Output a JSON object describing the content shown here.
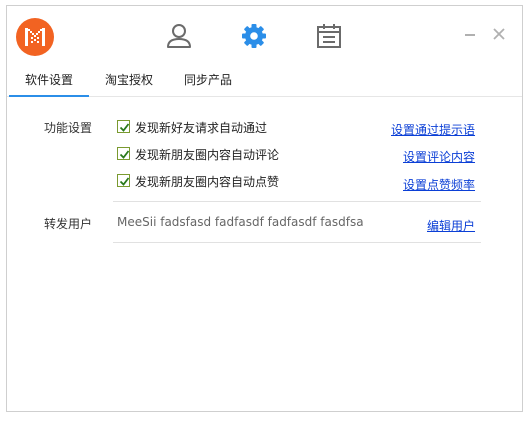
{
  "header": {
    "icons": [
      "app-logo",
      "user-icon",
      "gear-icon",
      "calendar-icon"
    ],
    "active_icon": "gear-icon",
    "accent_color": "#2b8ee8",
    "logo_color": "#f26322"
  },
  "tabs": [
    {
      "label": "软件设置",
      "active": true
    },
    {
      "label": "淘宝授权",
      "active": false
    },
    {
      "label": "同步产品",
      "active": false
    }
  ],
  "settings": {
    "function_label": "功能设置",
    "options": [
      {
        "label": "发现新好友请求自动通过",
        "checked": true,
        "link": "设置通过提示语"
      },
      {
        "label": "发现新朋友圈内容自动评论",
        "checked": true,
        "link": "设置评论内容"
      },
      {
        "label": "发现新朋友圈内容自动点赞",
        "checked": true,
        "link": "设置点赞频率"
      }
    ],
    "forward_label": "转发用户",
    "forward_users": "MeeSii fadsfasd fadfasdf fadfasdf fasdfsa",
    "edit_users_link": "编辑用户"
  }
}
